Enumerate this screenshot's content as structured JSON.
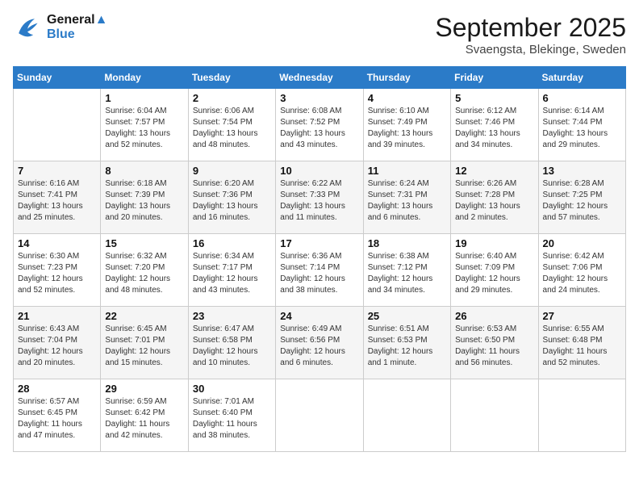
{
  "logo": {
    "line1": "General",
    "line2": "Blue"
  },
  "title": "September 2025",
  "location": "Svaengsta, Blekinge, Sweden",
  "weekdays": [
    "Sunday",
    "Monday",
    "Tuesday",
    "Wednesday",
    "Thursday",
    "Friday",
    "Saturday"
  ],
  "weeks": [
    [
      {
        "day": "",
        "info": ""
      },
      {
        "day": "1",
        "info": "Sunrise: 6:04 AM\nSunset: 7:57 PM\nDaylight: 13 hours\nand 52 minutes."
      },
      {
        "day": "2",
        "info": "Sunrise: 6:06 AM\nSunset: 7:54 PM\nDaylight: 13 hours\nand 48 minutes."
      },
      {
        "day": "3",
        "info": "Sunrise: 6:08 AM\nSunset: 7:52 PM\nDaylight: 13 hours\nand 43 minutes."
      },
      {
        "day": "4",
        "info": "Sunrise: 6:10 AM\nSunset: 7:49 PM\nDaylight: 13 hours\nand 39 minutes."
      },
      {
        "day": "5",
        "info": "Sunrise: 6:12 AM\nSunset: 7:46 PM\nDaylight: 13 hours\nand 34 minutes."
      },
      {
        "day": "6",
        "info": "Sunrise: 6:14 AM\nSunset: 7:44 PM\nDaylight: 13 hours\nand 29 minutes."
      }
    ],
    [
      {
        "day": "7",
        "info": "Sunrise: 6:16 AM\nSunset: 7:41 PM\nDaylight: 13 hours\nand 25 minutes."
      },
      {
        "day": "8",
        "info": "Sunrise: 6:18 AM\nSunset: 7:39 PM\nDaylight: 13 hours\nand 20 minutes."
      },
      {
        "day": "9",
        "info": "Sunrise: 6:20 AM\nSunset: 7:36 PM\nDaylight: 13 hours\nand 16 minutes."
      },
      {
        "day": "10",
        "info": "Sunrise: 6:22 AM\nSunset: 7:33 PM\nDaylight: 13 hours\nand 11 minutes."
      },
      {
        "day": "11",
        "info": "Sunrise: 6:24 AM\nSunset: 7:31 PM\nDaylight: 13 hours\nand 6 minutes."
      },
      {
        "day": "12",
        "info": "Sunrise: 6:26 AM\nSunset: 7:28 PM\nDaylight: 13 hours\nand 2 minutes."
      },
      {
        "day": "13",
        "info": "Sunrise: 6:28 AM\nSunset: 7:25 PM\nDaylight: 12 hours\nand 57 minutes."
      }
    ],
    [
      {
        "day": "14",
        "info": "Sunrise: 6:30 AM\nSunset: 7:23 PM\nDaylight: 12 hours\nand 52 minutes."
      },
      {
        "day": "15",
        "info": "Sunrise: 6:32 AM\nSunset: 7:20 PM\nDaylight: 12 hours\nand 48 minutes."
      },
      {
        "day": "16",
        "info": "Sunrise: 6:34 AM\nSunset: 7:17 PM\nDaylight: 12 hours\nand 43 minutes."
      },
      {
        "day": "17",
        "info": "Sunrise: 6:36 AM\nSunset: 7:14 PM\nDaylight: 12 hours\nand 38 minutes."
      },
      {
        "day": "18",
        "info": "Sunrise: 6:38 AM\nSunset: 7:12 PM\nDaylight: 12 hours\nand 34 minutes."
      },
      {
        "day": "19",
        "info": "Sunrise: 6:40 AM\nSunset: 7:09 PM\nDaylight: 12 hours\nand 29 minutes."
      },
      {
        "day": "20",
        "info": "Sunrise: 6:42 AM\nSunset: 7:06 PM\nDaylight: 12 hours\nand 24 minutes."
      }
    ],
    [
      {
        "day": "21",
        "info": "Sunrise: 6:43 AM\nSunset: 7:04 PM\nDaylight: 12 hours\nand 20 minutes."
      },
      {
        "day": "22",
        "info": "Sunrise: 6:45 AM\nSunset: 7:01 PM\nDaylight: 12 hours\nand 15 minutes."
      },
      {
        "day": "23",
        "info": "Sunrise: 6:47 AM\nSunset: 6:58 PM\nDaylight: 12 hours\nand 10 minutes."
      },
      {
        "day": "24",
        "info": "Sunrise: 6:49 AM\nSunset: 6:56 PM\nDaylight: 12 hours\nand 6 minutes."
      },
      {
        "day": "25",
        "info": "Sunrise: 6:51 AM\nSunset: 6:53 PM\nDaylight: 12 hours\nand 1 minute."
      },
      {
        "day": "26",
        "info": "Sunrise: 6:53 AM\nSunset: 6:50 PM\nDaylight: 11 hours\nand 56 minutes."
      },
      {
        "day": "27",
        "info": "Sunrise: 6:55 AM\nSunset: 6:48 PM\nDaylight: 11 hours\nand 52 minutes."
      }
    ],
    [
      {
        "day": "28",
        "info": "Sunrise: 6:57 AM\nSunset: 6:45 PM\nDaylight: 11 hours\nand 47 minutes."
      },
      {
        "day": "29",
        "info": "Sunrise: 6:59 AM\nSunset: 6:42 PM\nDaylight: 11 hours\nand 42 minutes."
      },
      {
        "day": "30",
        "info": "Sunrise: 7:01 AM\nSunset: 6:40 PM\nDaylight: 11 hours\nand 38 minutes."
      },
      {
        "day": "",
        "info": ""
      },
      {
        "day": "",
        "info": ""
      },
      {
        "day": "",
        "info": ""
      },
      {
        "day": "",
        "info": ""
      }
    ]
  ]
}
